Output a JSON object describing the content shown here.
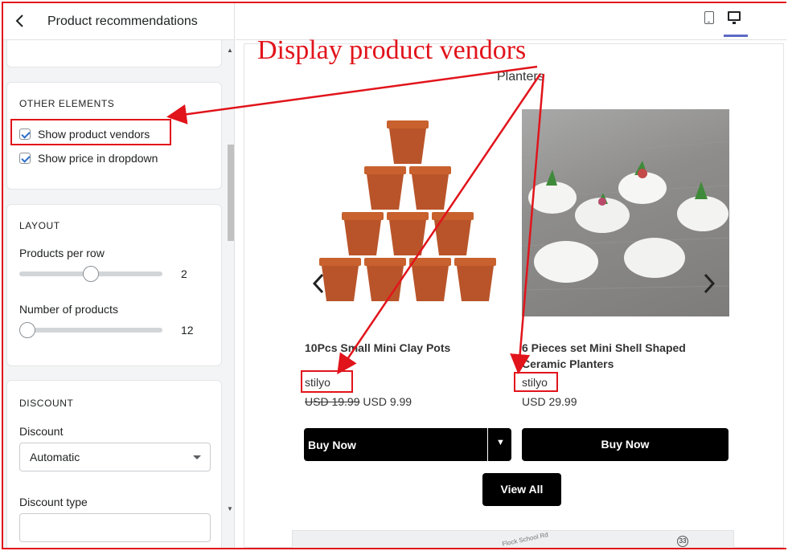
{
  "left_panel": {
    "title": "Product recommendations",
    "icons": {
      "back": "chevron-left-icon"
    },
    "other_elements": {
      "heading": "OTHER ELEMENTS",
      "show_vendors": {
        "label": "Show product vendors",
        "checked": true
      },
      "show_price": {
        "label": "Show price in dropdown",
        "checked": true
      }
    },
    "layout": {
      "heading": "LAYOUT",
      "products_per_row": {
        "label": "Products per row",
        "value": "2",
        "fill": 0.5
      },
      "number_of_products": {
        "label": "Number of products",
        "value": "12",
        "fill": 0.0
      }
    },
    "discount": {
      "heading": "DISCOUNT",
      "discount_label": "Discount",
      "discount_value": "Automatic",
      "discount_type_label": "Discount type"
    }
  },
  "preview": {
    "annotation": "Display product vendors",
    "collection": "Planters",
    "products": [
      {
        "title": "10Pcs Small Mini Clay Pots",
        "vendor": "stilyo",
        "compare_price": "USD 19.99",
        "price": "USD 9.99",
        "button": "Buy Now",
        "dropdown_glyph": "▼"
      },
      {
        "title": "6 Pieces set Mini Shell Shaped Ceramic Planters",
        "vendor": "stilyo",
        "price": "USD 29.99",
        "button": "Buy Now"
      }
    ],
    "view_all": "View All",
    "map": {
      "road": "Flock School Rd",
      "route": "33"
    }
  },
  "colors": {
    "annotation_red": "#e1141b",
    "accent": "#5c6ac4",
    "checkbox": "#2c6ecb",
    "button": "#000000"
  }
}
